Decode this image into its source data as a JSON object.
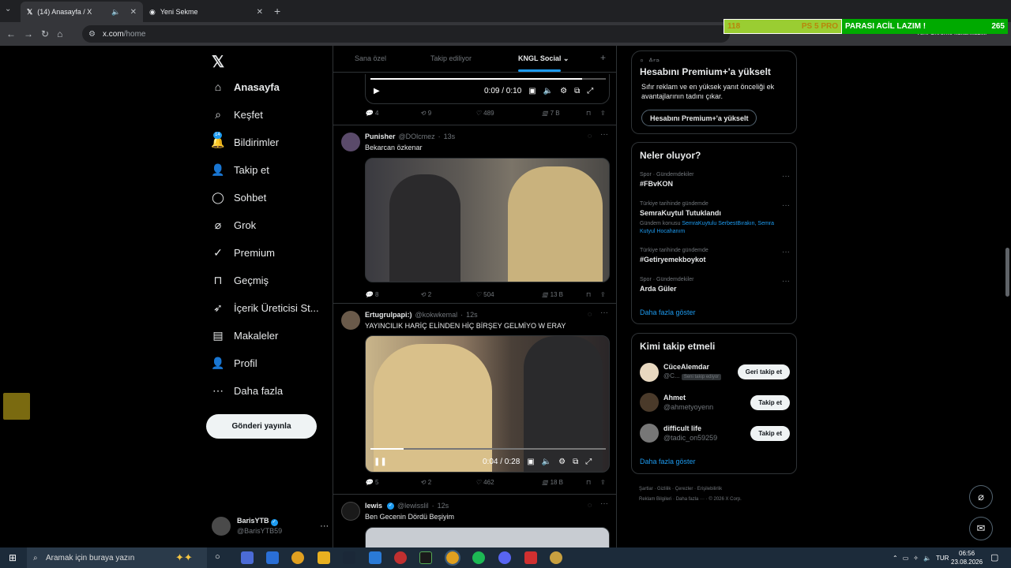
{
  "browser": {
    "tabs": [
      {
        "title": "(14) Anasayfa / X",
        "active": true
      },
      {
        "title": "Yeni Sekme",
        "active": false
      }
    ],
    "url_host": "x.com",
    "url_path": "/home",
    "profile_label": "Yeni Chrome kullanılabilir"
  },
  "overlay": {
    "left_num": "118",
    "left_text": "PS 5 PRO",
    "right_text": "PARASI ACİL LAZIM !",
    "right_num": "265"
  },
  "nav": {
    "items": [
      {
        "label": "Anasayfa",
        "icon": "home-icon"
      },
      {
        "label": "Keşfet",
        "icon": "search-icon"
      },
      {
        "label": "Bildirimler",
        "icon": "bell-icon",
        "badge": "14"
      },
      {
        "label": "Takip et",
        "icon": "add-user-icon"
      },
      {
        "label": "Sohbet",
        "icon": "chat-icon"
      },
      {
        "label": "Grok",
        "icon": "grok-icon"
      },
      {
        "label": "Premium",
        "icon": "verified-icon"
      },
      {
        "label": "Geçmiş",
        "icon": "bookmark-icon"
      },
      {
        "label": "İçerik Üreticisi St...",
        "icon": "rocket-icon"
      },
      {
        "label": "Makaleler",
        "icon": "article-icon"
      },
      {
        "label": "Profil",
        "icon": "profile-icon"
      },
      {
        "label": "Daha fazla",
        "icon": "more-circle-icon"
      }
    ],
    "post_button": "Gönderi yayınla",
    "user": {
      "name": "BarisYTB",
      "handle": "@BarisYTB59"
    }
  },
  "feed": {
    "tabs": [
      "Sana özel",
      "Takip ediliyor",
      "KNGL Social"
    ],
    "top_video": {
      "time": "0:09 / 0:10",
      "progress": 0.9
    },
    "top_actions": {
      "replies": "4",
      "reposts": "9",
      "likes": "489",
      "views": "7 B"
    },
    "tweets": [
      {
        "name": "Punisher",
        "handle": "@DOlcmez",
        "time": "13s",
        "text": "Bekarcan özkenar",
        "actions": {
          "replies": "8",
          "reposts": "2",
          "likes": "504",
          "views": "13 B"
        }
      },
      {
        "name": "Ertugrulpapi:)",
        "handle": "@kokwkemal",
        "time": "12s",
        "text": "YAYINCILIK HARİÇ ELİNDEN HİÇ BİRŞEY GELMİYO W ERAY",
        "video_time": "0:04 / 0:28",
        "video_progress": 0.14,
        "actions": {
          "replies": "5",
          "reposts": "2",
          "likes": "462",
          "views": "18 B"
        }
      },
      {
        "name": "lewis",
        "handle": "@lewisslil",
        "time": "12s",
        "text": "Ben Gecenin Dördü Beşiyim"
      }
    ]
  },
  "sidebar": {
    "search_placeholder": "Ara",
    "premium": {
      "title": "Hesabını Premium+'a yükselt",
      "desc": "Sıfır reklam ve en yüksek yanıt önceliği ek avantajlarının tadını çıkar.",
      "button": "Hesabını Premium+'a yükselt"
    },
    "trends_title": "Neler oluyor?",
    "trends": [
      {
        "context": "Spor · Gündemdekiler",
        "title": "#FBvKON"
      },
      {
        "context": "Türkiye tarihinde gündemde",
        "title": "SemraKuytul Tutuklandı",
        "sub_prefix": "Gündem konusu ",
        "sub_links": "SemraKuytulu SerbestBırakın, Semra Kutyul Hocahanım"
      },
      {
        "context": "Türkiye tarihinde gündemde",
        "title": "#Getiryemekboykot"
      },
      {
        "context": "Spor · Gündemdekiler",
        "title": "Arda Güler"
      }
    ],
    "show_more": "Daha fazla göster",
    "who_title": "Kimi takip etmeli",
    "who": [
      {
        "name": "CüceAlemdar",
        "handle": "@C...",
        "tag": "Seni takip ediyor",
        "button": "Geri takip et"
      },
      {
        "name": "Ahmet",
        "handle": "@ahmetyoyenn",
        "button": "Takip et"
      },
      {
        "name": "difficult life",
        "handle": "@tadic_on59259",
        "button": "Takip et"
      }
    ],
    "who_more": "Daha fazla göster",
    "footer": [
      "Şartlar",
      "Gizlilik",
      "Çerezler",
      "Erişilebilirlik",
      "Reklam Bilgileri",
      "Daha fazla ···",
      "© 2026 X Corp."
    ]
  },
  "taskbar": {
    "search_placeholder": "Aramak için buraya yazın",
    "lang": "TUR",
    "time": "06:56",
    "date": "23.08.2026"
  }
}
